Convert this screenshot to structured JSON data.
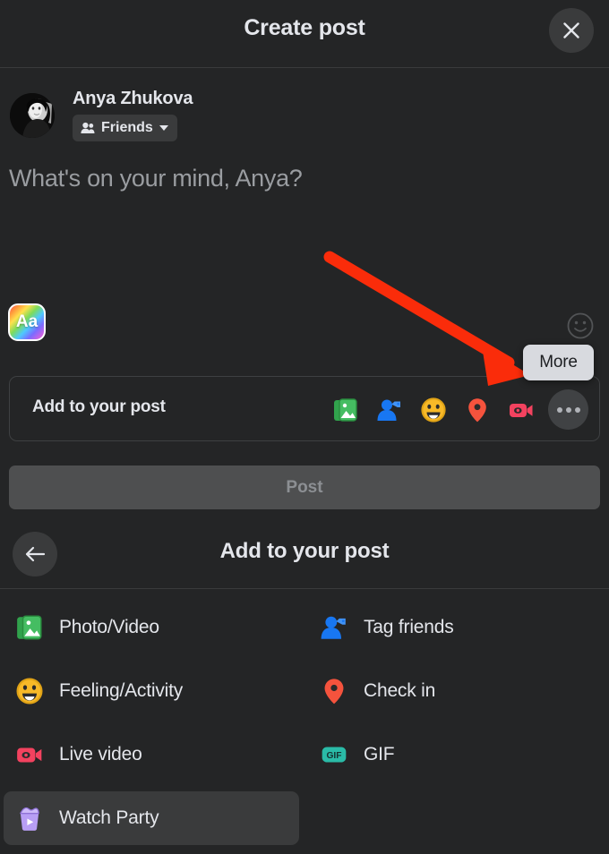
{
  "header": {
    "title": "Create post",
    "close_icon": "close-icon"
  },
  "author": {
    "name": "Anya Zhukova",
    "audience": "Friends",
    "audience_icon": "friends-group-icon",
    "caret_icon": "chevron-down-icon",
    "avatar_icon": "avatar"
  },
  "composer": {
    "placeholder": "What's on your mind, Anya?",
    "text_style_button": "Aa",
    "emoji_icon": "smiley-outline-icon"
  },
  "add_bar": {
    "label": "Add to your post",
    "icons": [
      {
        "name": "photo-video-icon",
        "color": "#45bd62"
      },
      {
        "name": "tag-friends-icon",
        "color": "#1877f2"
      },
      {
        "name": "feeling-activity-icon",
        "color": "#f7b928"
      },
      {
        "name": "check-in-icon",
        "color": "#f5533d"
      },
      {
        "name": "live-video-icon",
        "color": "#f3425f"
      },
      {
        "name": "more-icon",
        "color": "#b0b3b8"
      }
    ]
  },
  "tooltip": {
    "label": "More"
  },
  "post_button": {
    "label": "Post"
  },
  "sheet": {
    "title": "Add to your post",
    "back_icon": "back-arrow-icon"
  },
  "menu": {
    "items": [
      {
        "label": "Photo/Video",
        "icon": "photo-video-icon",
        "color": "#45bd62",
        "column": "left",
        "row": 0,
        "highlighted": false
      },
      {
        "label": "Tag friends",
        "icon": "tag-friends-icon",
        "color": "#1877f2",
        "column": "right",
        "row": 0,
        "highlighted": false
      },
      {
        "label": "Feeling/Activity",
        "icon": "feeling-activity-icon",
        "color": "#f7b928",
        "column": "left",
        "row": 1,
        "highlighted": false
      },
      {
        "label": "Check in",
        "icon": "check-in-icon",
        "color": "#f5533d",
        "column": "right",
        "row": 1,
        "highlighted": false
      },
      {
        "label": "Live video",
        "icon": "live-video-icon",
        "color": "#f3425f",
        "column": "left",
        "row": 2,
        "highlighted": false
      },
      {
        "label": "GIF",
        "icon": "gif-icon",
        "color": "#2abba7",
        "column": "right",
        "row": 2,
        "highlighted": false
      },
      {
        "label": "Watch Party",
        "icon": "watch-party-icon",
        "color": "#a78bfa",
        "column": "left",
        "row": 3,
        "highlighted": true
      }
    ]
  },
  "annotation": {
    "arrow_color": "#fa2c0a"
  },
  "colors": {
    "background": "#242526",
    "surface": "#3a3b3c",
    "text_primary": "#e4e6eb",
    "text_secondary": "#b0b3b8",
    "tooltip_bg": "#d8dadf"
  }
}
